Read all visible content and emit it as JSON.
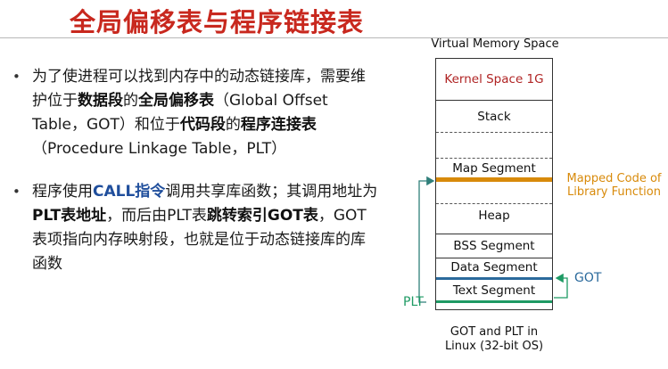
{
  "page": {
    "title": "全局偏移表与程序链接表"
  },
  "bullets": [
    {
      "parts": [
        {
          "t": "为了使进程可以找到内存中的动态链接库，需要维护位于"
        },
        {
          "t": "数据段",
          "b": true
        },
        {
          "t": "的"
        },
        {
          "t": "全局偏移表",
          "b": true
        },
        {
          "t": "（Global Offset Table，GOT）和位于"
        },
        {
          "t": "代码段",
          "b": true
        },
        {
          "t": "的"
        },
        {
          "t": "程序连接表",
          "b": true
        },
        {
          "t": "（Procedure Linkage Table，PLT）"
        }
      ]
    },
    {
      "parts": [
        {
          "t": "程序使用"
        },
        {
          "t": "CALL指令",
          "b": true,
          "blue": true
        },
        {
          "t": "调用共享库函数；其调用地址为"
        },
        {
          "t": "PLT表地址",
          "b": true
        },
        {
          "t": "，而后由PLT表"
        },
        {
          "t": "跳转索引GOT表",
          "b": true
        },
        {
          "t": "，GOT表项指向内存映射段，也就是位于动态链接库的库函数"
        }
      ]
    }
  ],
  "diagram": {
    "title": "Virtual Memory Space",
    "segments": {
      "kernel": "Kernel Space 1G",
      "stack": "Stack",
      "map": "Map Segment",
      "heap": "Heap",
      "bss": "BSS Segment",
      "data": "Data Segment",
      "text": "Text Segment"
    },
    "mapped_note": "Mapped Code of Library Function",
    "got_label": "GOT",
    "plt_label": "PLT",
    "caption_line1": "GOT and PLT in",
    "caption_line2": "Linux (32-bit OS)",
    "colors": {
      "title": "#c8281e",
      "kernel": "#b02424",
      "mapped": "#d88a0a",
      "got": "#2b6a9c",
      "plt": "#1e9a64",
      "call_blue": "#1f4e9c"
    }
  }
}
